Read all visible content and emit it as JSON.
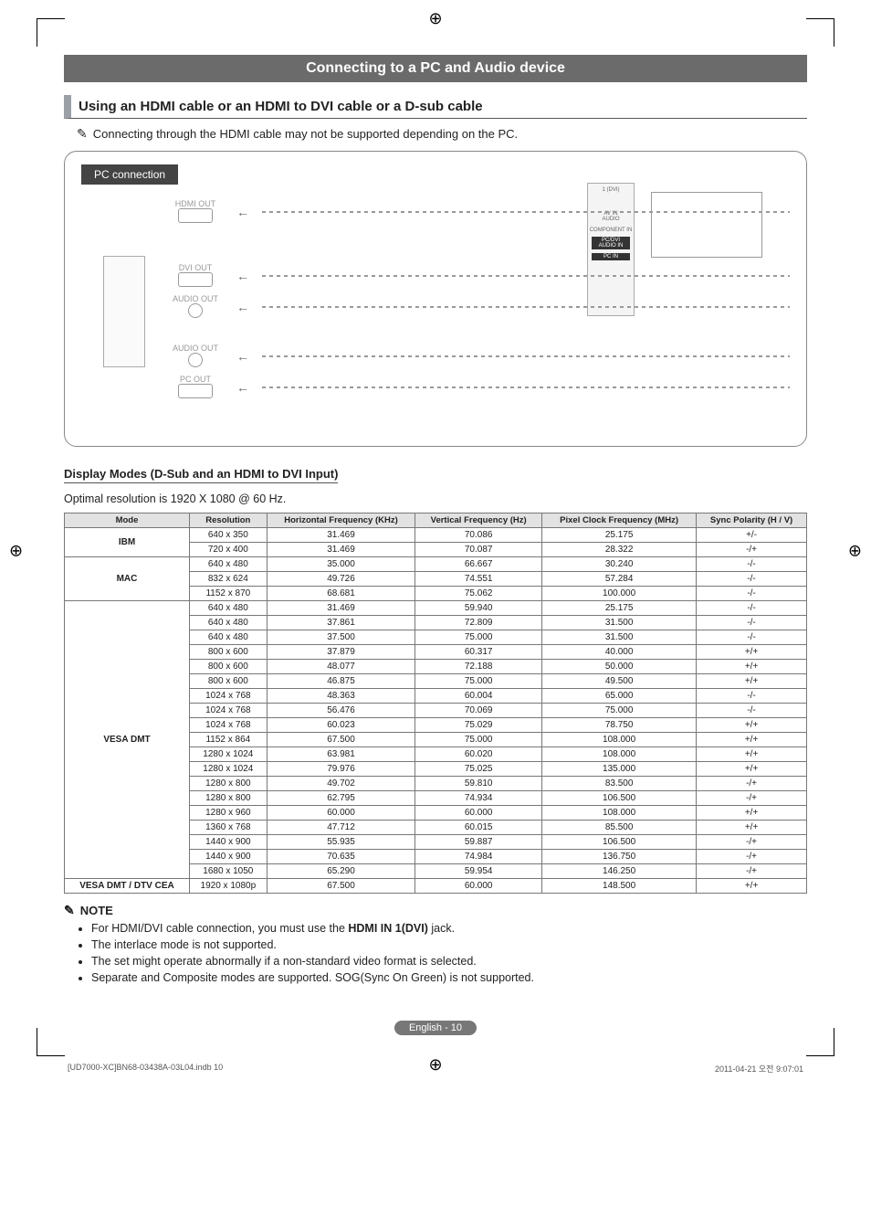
{
  "title": "Connecting to a PC and Audio device",
  "section_heading": "Using an HDMI cable or an HDMI to DVI cable or a D-sub cable",
  "hdmi_note": "Connecting through the HDMI cable may not be supported depending on the PC.",
  "diagram": {
    "label": "PC connection",
    "ports": {
      "hdmi_out": "HDMI OUT",
      "dvi_out": "DVI OUT",
      "audio_out1": "AUDIO OUT",
      "audio_out2": "AUDIO OUT",
      "pc_out": "PC OUT"
    },
    "tv_panel_labels": [
      "1 (DVI)",
      "AV IN",
      "AUDIO",
      "COMPONENT IN",
      "PC/DVI AUDIO IN",
      "PC IN"
    ]
  },
  "sub_heading": "Display Modes (D-Sub and an HDMI to DVI Input)",
  "optimal_text": "Optimal resolution is 1920 X 1080 @ 60 Hz.",
  "chart_data": {
    "type": "table",
    "title": "Display Modes (D-Sub and an HDMI to DVI Input)",
    "columns": [
      "Mode",
      "Resolution",
      "Horizontal Frequency (KHz)",
      "Vertical Frequency (Hz)",
      "Pixel Clock Frequency (MHz)",
      "Sync Polarity (H / V)"
    ],
    "groups": [
      {
        "mode": "IBM",
        "rows": [
          [
            "640 x 350",
            "31.469",
            "70.086",
            "25.175",
            "+/-"
          ],
          [
            "720 x 400",
            "31.469",
            "70.087",
            "28.322",
            "-/+"
          ]
        ]
      },
      {
        "mode": "MAC",
        "rows": [
          [
            "640 x 480",
            "35.000",
            "66.667",
            "30.240",
            "-/-"
          ],
          [
            "832 x 624",
            "49.726",
            "74.551",
            "57.284",
            "-/-"
          ],
          [
            "1152 x 870",
            "68.681",
            "75.062",
            "100.000",
            "-/-"
          ]
        ]
      },
      {
        "mode": "VESA DMT",
        "rows": [
          [
            "640 x 480",
            "31.469",
            "59.940",
            "25.175",
            "-/-"
          ],
          [
            "640 x 480",
            "37.861",
            "72.809",
            "31.500",
            "-/-"
          ],
          [
            "640 x 480",
            "37.500",
            "75.000",
            "31.500",
            "-/-"
          ],
          [
            "800 x 600",
            "37.879",
            "60.317",
            "40.000",
            "+/+"
          ],
          [
            "800 x 600",
            "48.077",
            "72.188",
            "50.000",
            "+/+"
          ],
          [
            "800 x 600",
            "46.875",
            "75.000",
            "49.500",
            "+/+"
          ],
          [
            "1024 x 768",
            "48.363",
            "60.004",
            "65.000",
            "-/-"
          ],
          [
            "1024 x 768",
            "56.476",
            "70.069",
            "75.000",
            "-/-"
          ],
          [
            "1024 x 768",
            "60.023",
            "75.029",
            "78.750",
            "+/+"
          ],
          [
            "1152 x 864",
            "67.500",
            "75.000",
            "108.000",
            "+/+"
          ],
          [
            "1280 x 1024",
            "63.981",
            "60.020",
            "108.000",
            "+/+"
          ],
          [
            "1280 x 1024",
            "79.976",
            "75.025",
            "135.000",
            "+/+"
          ],
          [
            "1280 x 800",
            "49.702",
            "59.810",
            "83.500",
            "-/+"
          ],
          [
            "1280 x 800",
            "62.795",
            "74.934",
            "106.500",
            "-/+"
          ],
          [
            "1280 x 960",
            "60.000",
            "60.000",
            "108.000",
            "+/+"
          ],
          [
            "1360 x 768",
            "47.712",
            "60.015",
            "85.500",
            "+/+"
          ],
          [
            "1440 x 900",
            "55.935",
            "59.887",
            "106.500",
            "-/+"
          ],
          [
            "1440 x 900",
            "70.635",
            "74.984",
            "136.750",
            "-/+"
          ],
          [
            "1680 x 1050",
            "65.290",
            "59.954",
            "146.250",
            "-/+"
          ]
        ]
      },
      {
        "mode": "VESA DMT / DTV CEA",
        "rows": [
          [
            "1920 x 1080p",
            "67.500",
            "60.000",
            "148.500",
            "+/+"
          ]
        ]
      }
    ]
  },
  "note_heading": "NOTE",
  "notes": [
    {
      "pre": "For HDMI/DVI cable connection, you must use the ",
      "bold": "HDMI IN 1(DVI)",
      "post": " jack."
    },
    {
      "pre": "The interlace mode is not supported.",
      "bold": "",
      "post": ""
    },
    {
      "pre": "The set might operate abnormally if a non-standard video format is selected.",
      "bold": "",
      "post": ""
    },
    {
      "pre": "Separate and Composite modes are supported. SOG(Sync On Green) is not supported.",
      "bold": "",
      "post": ""
    }
  ],
  "footer": {
    "page_label": "English - 10",
    "indd": "[UD7000-XC]BN68-03438A-03L04.indb   10",
    "timestamp": "2011-04-21   오전 9:07:01"
  }
}
